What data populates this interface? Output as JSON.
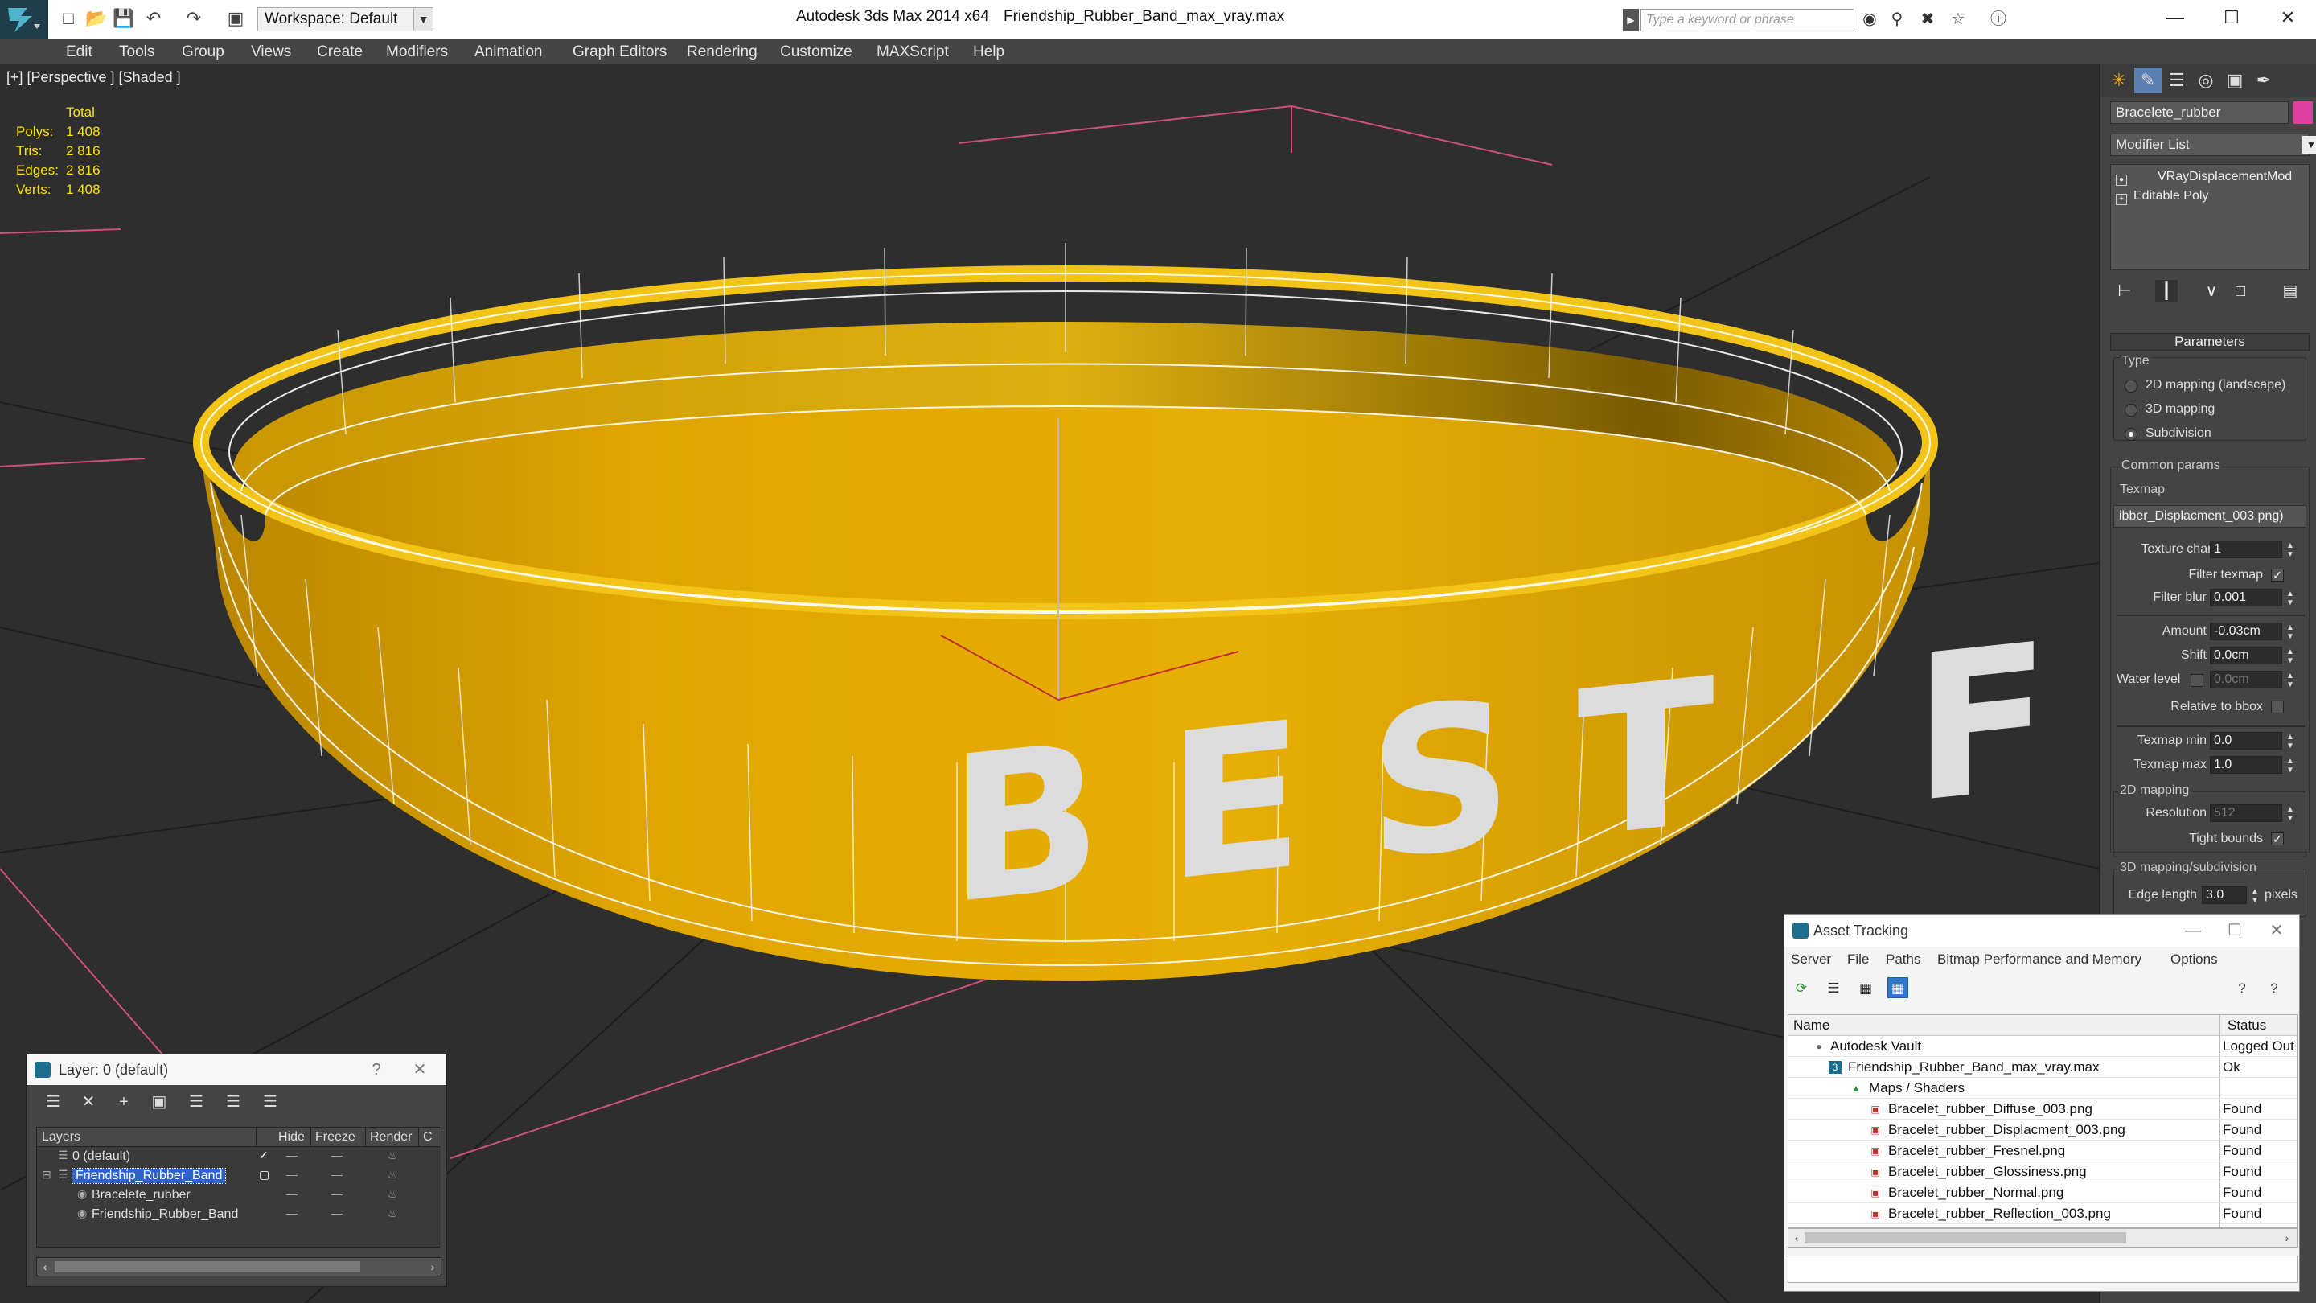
{
  "titlebar": {
    "workspace": "Workspace: Default",
    "app_title": "Autodesk 3ds Max  2014 x64",
    "file_name": "Friendship_Rubber_Band_max_vray.max",
    "search_placeholder": "Type a keyword or phrase"
  },
  "menu": [
    "Edit",
    "Tools",
    "Group",
    "Views",
    "Create",
    "Modifiers",
    "Animation",
    "Graph Editors",
    "Rendering",
    "Customize",
    "MAXScript",
    "Help"
  ],
  "viewport": {
    "label": "[+] [Perspective ] [Shaded ]",
    "stats": {
      "header": "Total",
      "rows": [
        {
          "label": "Polys:",
          "value": "1 408"
        },
        {
          "label": "Tris:",
          "value": "2 816"
        },
        {
          "label": "Edges:",
          "value": "2 816"
        },
        {
          "label": "Verts:",
          "value": "1 408"
        }
      ]
    },
    "band_text": "BEST FR",
    "band_color": "#e0a800"
  },
  "command_panel": {
    "object_name": "Bracelete_rubber",
    "object_color": "#e040a0",
    "modifier_list": "Modifier List",
    "stack": [
      "VRayDisplacementMod",
      "Editable Poly"
    ],
    "parameters_title": "Parameters",
    "type_group": "Type",
    "type_options": [
      {
        "label": "2D mapping (landscape)",
        "selected": false
      },
      {
        "label": "3D mapping",
        "selected": false
      },
      {
        "label": "Subdivision",
        "selected": true
      }
    ],
    "common_group": "Common params",
    "texmap_label": "Texmap",
    "texmap_value": "ibber_Displacment_003.png)",
    "texture_chan_label": "Texture chan",
    "texture_chan_value": "1",
    "filter_texmap_label": "Filter texmap",
    "filter_blur_label": "Filter blur",
    "filter_blur_value": "0.001",
    "amount_label": "Amount",
    "amount_value": "-0.03cm",
    "shift_label": "Shift",
    "shift_value": "0.0cm",
    "water_level_label": "Water level",
    "water_level_value": "0.0cm",
    "relative_bbox_label": "Relative to bbox",
    "texmap_min_label": "Texmap min",
    "texmap_min_value": "0.0",
    "texmap_max_label": "Texmap max",
    "texmap_max_value": "1.0",
    "mapping2d_group": "2D mapping",
    "resolution_label": "Resolution",
    "resolution_value": "512",
    "tight_bounds_label": "Tight bounds",
    "mapping3d_group": "3D mapping/subdivision",
    "edge_length_label": "Edge length",
    "edge_length_value": "3.0",
    "edge_length_unit": "pixels"
  },
  "asset_tracking": {
    "title": "Asset Tracking",
    "menu": [
      "Server",
      "File",
      "Paths",
      "Bitmap Performance and Memory",
      "Options"
    ],
    "columns": {
      "name": "Name",
      "status": "Status"
    },
    "rows": [
      {
        "name": "Autodesk Vault",
        "status": "Logged Out"
      },
      {
        "name": "Friendship_Rubber_Band_max_vray.max",
        "status": "Ok"
      },
      {
        "name": "Maps / Shaders",
        "status": ""
      },
      {
        "name": "Bracelet_rubber_Diffuse_003.png",
        "status": "Found"
      },
      {
        "name": "Bracelet_rubber_Displacment_003.png",
        "status": "Found"
      },
      {
        "name": "Bracelet_rubber_Fresnel.png",
        "status": "Found"
      },
      {
        "name": "Bracelet_rubber_Glossiness.png",
        "status": "Found"
      },
      {
        "name": "Bracelet_rubber_Normal.png",
        "status": "Found"
      },
      {
        "name": "Bracelet_rubber_Reflection_003.png",
        "status": "Found"
      }
    ]
  },
  "layer_window": {
    "title": "Layer: 0 (default)",
    "help": "?",
    "columns": {
      "layers": "Layers",
      "hide": "Hide",
      "freeze": "Freeze",
      "render": "Render",
      "c": "C"
    },
    "rows": [
      {
        "name": "0 (default)",
        "hide": "—",
        "freeze": "—"
      },
      {
        "name": "Friendship_Rubber_Band",
        "hide": "—",
        "freeze": "—"
      },
      {
        "name": "Bracelete_rubber",
        "hide": "—",
        "freeze": "—"
      },
      {
        "name": "Friendship_Rubber_Band",
        "hide": "—",
        "freeze": "—"
      }
    ]
  }
}
